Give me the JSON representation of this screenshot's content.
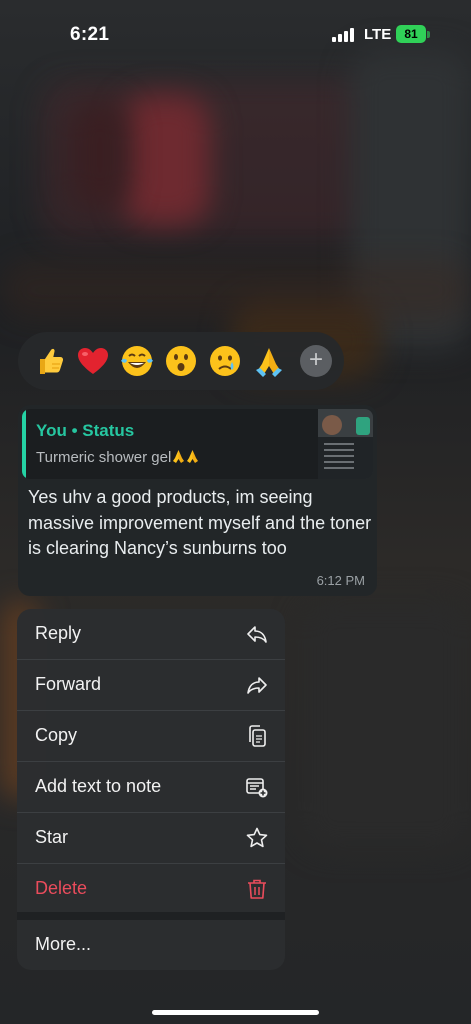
{
  "status_bar": {
    "time": "6:21",
    "network": "LTE",
    "battery": "81"
  },
  "reactions": [
    {
      "icon": "thumbs-up-emoji"
    },
    {
      "icon": "red-heart-emoji"
    },
    {
      "icon": "tears-of-joy-emoji"
    },
    {
      "icon": "surprised-face-emoji"
    },
    {
      "icon": "crying-face-emoji"
    },
    {
      "icon": "folded-hands-emoji"
    },
    {
      "icon": "plus-icon",
      "label": "+"
    }
  ],
  "message": {
    "quote_title": "You • Status",
    "quote_text": "Turmeric shower gel",
    "text": "Yes uhv a good products, im seeing massive improvement myself and the toner is clearing Nancy’s sunburns too",
    "time": "6:12 PM"
  },
  "menu": {
    "items": [
      {
        "label": "Reply",
        "icon": "reply-icon"
      },
      {
        "label": "Forward",
        "icon": "forward-icon"
      },
      {
        "label": "Copy",
        "icon": "copy-icon"
      },
      {
        "label": "Add text to note",
        "icon": "add-note-icon"
      },
      {
        "label": "Star",
        "icon": "star-icon"
      },
      {
        "label": "Delete",
        "icon": "trash-icon",
        "color": "#ea4c5c"
      },
      {
        "label": "More...",
        "icon": ""
      }
    ]
  },
  "colors": {
    "accent": "#26c6a0",
    "danger": "#ea4c5c",
    "battery": "#30d158"
  }
}
